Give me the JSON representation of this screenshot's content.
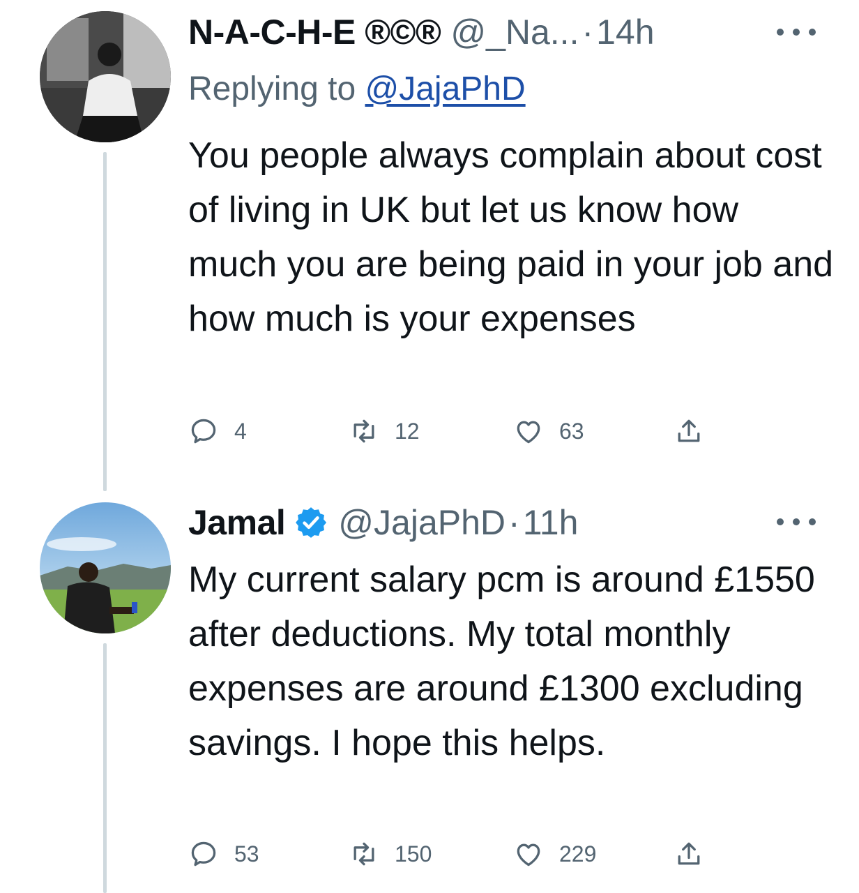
{
  "tweets": [
    {
      "display_name": "N-A-C-H-E ®©®",
      "handle": "@_Na...",
      "separator": "·",
      "time": "14h",
      "replying_prefix": "Replying to",
      "replying_handle": "@JajaPhD",
      "text": "You people always complain about cost of living in UK but let us know how much you are being paid in your job and how much is your expenses",
      "reply_count": "4",
      "retweet_count": "12",
      "like_count": "63",
      "verified": false
    },
    {
      "display_name": "Jamal",
      "handle": "@JajaPhD",
      "separator": "·",
      "time": "11h",
      "text": "My current salary pcm is around £1550 after deductions. My total monthly expenses are around £1300 excluding savings. I hope this helps.",
      "reply_count": "53",
      "retweet_count": "150",
      "like_count": "229",
      "verified": true
    }
  ],
  "icons": [
    "reply-icon",
    "retweet-icon",
    "like-icon",
    "share-icon",
    "more-icon",
    "verified-badge-icon"
  ],
  "colors": {
    "link": "#1d4fa8",
    "secondary": "#536471",
    "verified": "#1d9bf0",
    "thread_line": "#cfd9de"
  }
}
